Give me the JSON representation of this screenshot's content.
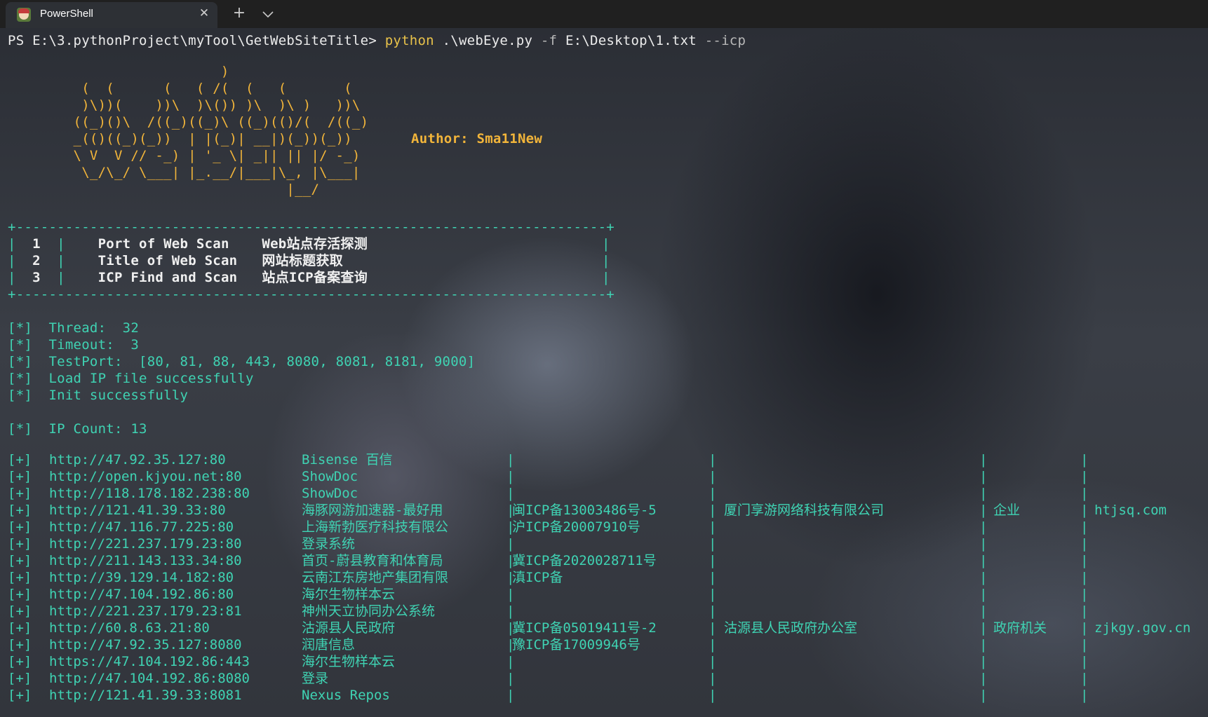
{
  "tab": {
    "icon": "avatar-app-icon",
    "title": "PowerShell",
    "close_icon": "close-icon",
    "new_tab_icon": "plus-icon",
    "dropdown_icon": "chevron-down-icon"
  },
  "prompt": {
    "path": "PS E:\\3.pythonProject\\myTool\\GetWebSiteTitle>",
    "command": "python",
    "script": ".\\webEye.py",
    "flag_f": "-f",
    "file": "E:\\Desktop\\1.txt",
    "flag_icp": "--icp"
  },
  "banner": {
    "lines": [
      "                          )",
      "         (  (      (   ( /(  (   (       (",
      "         )\\))(    ))\\  )\\()) )\\  )\\ )   ))\\",
      "        ((_)()\\  /((_)((_)\\ ((_)(()/(  /((_)",
      "        _(()((_)(_))  | |(_)| __|)(_))(_))",
      "        \\ V  V // -_) | '_ \\| _|| || |/ -_)",
      "         \\_/\\_/ \\___| |_.__/|___|\\_, |\\___|",
      "                                  |__/"
    ],
    "author": "Author: Sma11New"
  },
  "menu": {
    "border": "+------------------------------------------------------------------------+",
    "items": [
      {
        "num": "1",
        "name": "Port of Web Scan ",
        "desc": "Web站点存活探测"
      },
      {
        "num": "2",
        "name": "Title of Web Scan",
        "desc": "网站标题获取"
      },
      {
        "num": "3",
        "name": "ICP Find and Scan",
        "desc": "站点ICP备案查询"
      }
    ]
  },
  "info": [
    {
      "tag": "[*]",
      "text": "Thread:  32"
    },
    {
      "tag": "[*]",
      "text": "Timeout:  3"
    },
    {
      "tag": "[*]",
      "text": "TestPort:  [80, 81, 88, 443, 8080, 8081, 8181, 9000]"
    },
    {
      "tag": "[*]",
      "text": "Load IP file successfully"
    },
    {
      "tag": "[*]",
      "text": "Init successfully"
    }
  ],
  "count": {
    "tag": "[*]",
    "text": "IP Count: 13"
  },
  "results": [
    {
      "tag": "[+]",
      "url": "http://47.92.35.127:80",
      "title": "Bisense 百信",
      "icp": "",
      "company": "",
      "type": "",
      "domain": ""
    },
    {
      "tag": "[+]",
      "url": "http://open.kjyou.net:80",
      "title": "ShowDoc",
      "icp": "",
      "company": "",
      "type": "",
      "domain": ""
    },
    {
      "tag": "[+]",
      "url": "http://118.178.182.238:80",
      "title": "ShowDoc",
      "icp": "",
      "company": "",
      "type": "",
      "domain": ""
    },
    {
      "tag": "[+]",
      "url": "http://121.41.39.33:80",
      "title": "海豚网游加速器-最好用",
      "icp": "闽ICP备13003486号-5",
      "company": "厦门享游网络科技有限公司",
      "type": "企业",
      "domain": "htjsq.com"
    },
    {
      "tag": "[+]",
      "url": "http://47.116.77.225:80",
      "title": "上海新勃医疗科技有限公",
      "icp": "沪ICP备20007910号",
      "company": "",
      "type": "",
      "domain": ""
    },
    {
      "tag": "[+]",
      "url": "http://221.237.179.23:80",
      "title": "登录系统",
      "icp": "",
      "company": "",
      "type": "",
      "domain": ""
    },
    {
      "tag": "[+]",
      "url": "http://211.143.133.34:80",
      "title": "首页-蔚县教育和体育局",
      "icp": "冀ICP备2020028711号",
      "company": "",
      "type": "",
      "domain": ""
    },
    {
      "tag": "[+]",
      "url": "http://39.129.14.182:80",
      "title": "云南江东房地产集团有限",
      "icp": "滇ICP备",
      "company": "",
      "type": "",
      "domain": ""
    },
    {
      "tag": "[+]",
      "url": "http://47.104.192.86:80",
      "title": "海尔生物样本云",
      "icp": "",
      "company": "",
      "type": "",
      "domain": ""
    },
    {
      "tag": "[+]",
      "url": "http://221.237.179.23:81",
      "title": "神州天立协同办公系统",
      "icp": "",
      "company": "",
      "type": "",
      "domain": ""
    },
    {
      "tag": "[+]",
      "url": "http://60.8.63.21:80",
      "title": "沽源县人民政府",
      "icp": "冀ICP备05019411号-2",
      "company": "沽源县人民政府办公室",
      "type": "政府机关",
      "domain": "zjkgy.gov.cn"
    },
    {
      "tag": "[+]",
      "url": "http://47.92.35.127:8080",
      "title": "润唐信息",
      "icp": "豫ICP备17009946号",
      "company": "",
      "type": "",
      "domain": ""
    },
    {
      "tag": "[+]",
      "url": "https://47.104.192.86:443",
      "title": "海尔生物样本云",
      "icp": "",
      "company": "",
      "type": "",
      "domain": ""
    },
    {
      "tag": "[+]",
      "url": "http://47.104.192.86:8080",
      "title": "登录",
      "icp": "",
      "company": "",
      "type": "",
      "domain": ""
    },
    {
      "tag": "[+]",
      "url": "http://121.41.39.33:8081",
      "title": "Nexus Repos",
      "icp": "",
      "company": "",
      "type": "",
      "domain": ""
    }
  ],
  "colors": {
    "prompt": "#ececec",
    "command": "#e8c24a",
    "flag": "#b8b8b8",
    "banner": "#f2b53a",
    "accent": "#3fd3b3"
  }
}
